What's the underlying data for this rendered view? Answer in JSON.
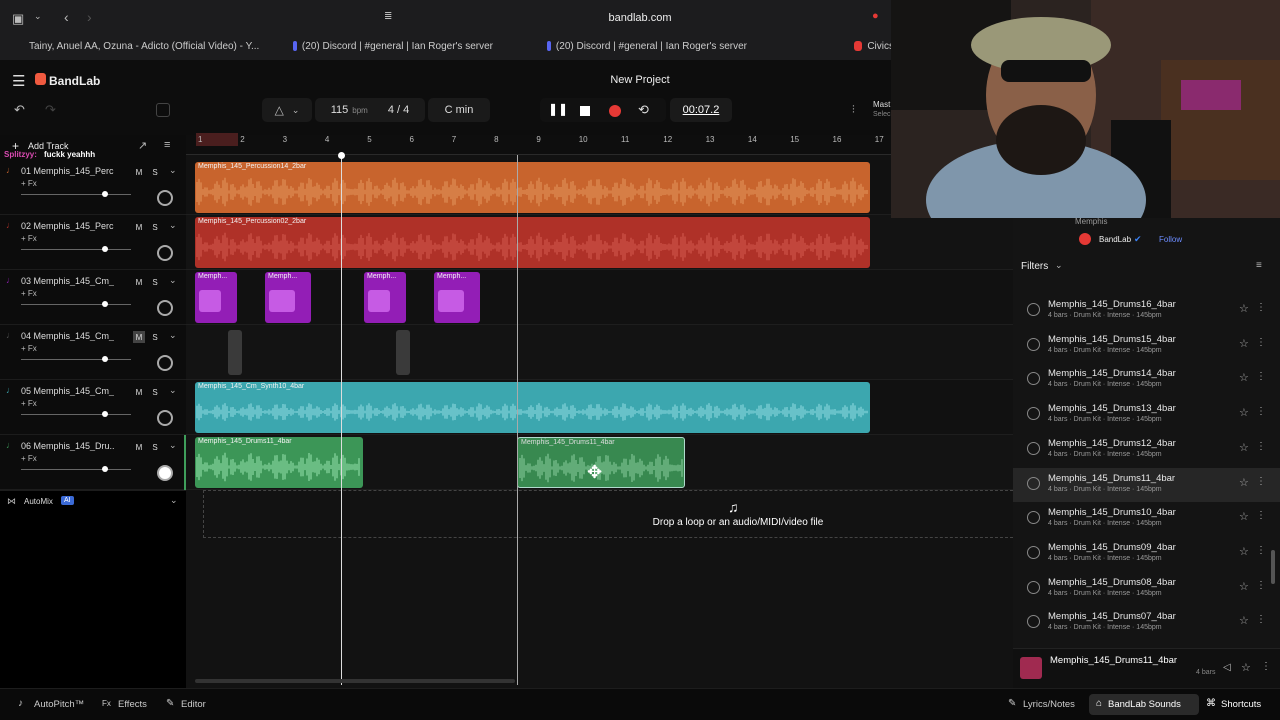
{
  "browser": {
    "url": "bandlab.com",
    "tabs": [
      {
        "title": "Tainy, Anuel AA, Ozuna - Adicto (Official Video) - Y...",
        "color": "#e53935"
      },
      {
        "title": "(20) Discord | #general | Ian Roger's server",
        "color": "#5865f2"
      },
      {
        "title": "(20) Discord | #general | Ian Roger's server",
        "color": "#5865f2"
      },
      {
        "title": "Civics",
        "color": "#e53935"
      }
    ]
  },
  "app": {
    "brand": "BandLab",
    "project_title": "New Project",
    "tempo_value": "115",
    "tempo_unit": "bpm",
    "time_signature": "4 / 4",
    "key": "C min",
    "time_display": "00:07.2",
    "master_label": "Mast",
    "master_sub": "Selec",
    "add_track_label": "Add Track",
    "chat_user": "Splitzyy:",
    "chat_message": "fuckk yeahhh",
    "automix_label": "AutoMix",
    "automix_badge": "AI",
    "drop_text": "Drop a loop or an audio/MIDI/video file"
  },
  "ruler": [
    "1",
    "2",
    "3",
    "4",
    "5",
    "6",
    "7",
    "8",
    "9",
    "10",
    "11",
    "12",
    "13",
    "14",
    "15",
    "16",
    "17"
  ],
  "tracks": [
    {
      "name": "01  Memphis_145_Perc...",
      "fx": "+ Fx",
      "color": "#d2692f",
      "regions": [
        {
          "label": "Memphis_145_Percussion14_2bar"
        }
      ]
    },
    {
      "name": "02  Memphis_145_Perc...",
      "fx": "+ Fx",
      "color": "#b8332a",
      "regions": [
        {
          "label": "Memphis_145_Percussion02_2bar"
        }
      ]
    },
    {
      "name": "03  Memphis_145_Cm_...",
      "fx": "+ Fx",
      "color": "#9b1fbf",
      "regions": [
        {
          "label": "Memph..."
        },
        {
          "label": "Memph..."
        },
        {
          "label": "Memph..."
        },
        {
          "label": "Memph..."
        }
      ]
    },
    {
      "name": "04  Memphis_145_Cm_...",
      "fx": "+ Fx",
      "color": "#555555",
      "regions": []
    },
    {
      "name": "05  Memphis_145_Cm_...",
      "fx": "+ Fx",
      "color": "#3fb0b8",
      "regions": [
        {
          "label": "Memphis_145_Cm_Synth10_4bar"
        }
      ]
    },
    {
      "name": "06  Memphis_145_Dru...",
      "fx": "+ Fx",
      "color": "#3f9e5b",
      "regions": [
        {
          "label": "Memphis_145_Drums11_4bar"
        },
        {
          "label": "Memphis_145_Drums11_4bar"
        }
      ]
    }
  ],
  "side": {
    "artist": "Memphis",
    "publisher": "BandLab",
    "follow": "Follow",
    "filters_label": "Filters",
    "items": [
      {
        "name": "Memphis_145_Drums16_4bar",
        "meta": "4 bars · Drum Kit · Intense · 145bpm"
      },
      {
        "name": "Memphis_145_Drums15_4bar",
        "meta": "4 bars · Drum Kit · Intense · 145bpm"
      },
      {
        "name": "Memphis_145_Drums14_4bar",
        "meta": "4 bars · Drum Kit · Intense · 145bpm"
      },
      {
        "name": "Memphis_145_Drums13_4bar",
        "meta": "4 bars · Drum Kit · Intense · 145bpm"
      },
      {
        "name": "Memphis_145_Drums12_4bar",
        "meta": "4 bars · Drum Kit · Intense · 145bpm"
      },
      {
        "name": "Memphis_145_Drums11_4bar",
        "meta": "4 bars · Drum Kit · Intense · 145bpm"
      },
      {
        "name": "Memphis_145_Drums10_4bar",
        "meta": "4 bars · Drum Kit · Intense · 145bpm"
      },
      {
        "name": "Memphis_145_Drums09_4bar",
        "meta": "4 bars · Drum Kit · Intense · 145bpm"
      },
      {
        "name": "Memphis_145_Drums08_4bar",
        "meta": "4 bars · Drum Kit · Intense · 145bpm"
      },
      {
        "name": "Memphis_145_Drums07_4bar",
        "meta": "4 bars · Drum Kit · Intense · 145bpm"
      }
    ],
    "now_playing_name": "Memphis_145_Drums11_4bar",
    "now_playing_meta": "4 bars"
  },
  "bottom_bar": {
    "autopitch": "AutoPitch™",
    "effects": "Effects",
    "editor": "Editor",
    "lyrics": "Lyrics/Notes",
    "sounds": "BandLab Sounds",
    "shortcuts": "Shortcuts"
  }
}
